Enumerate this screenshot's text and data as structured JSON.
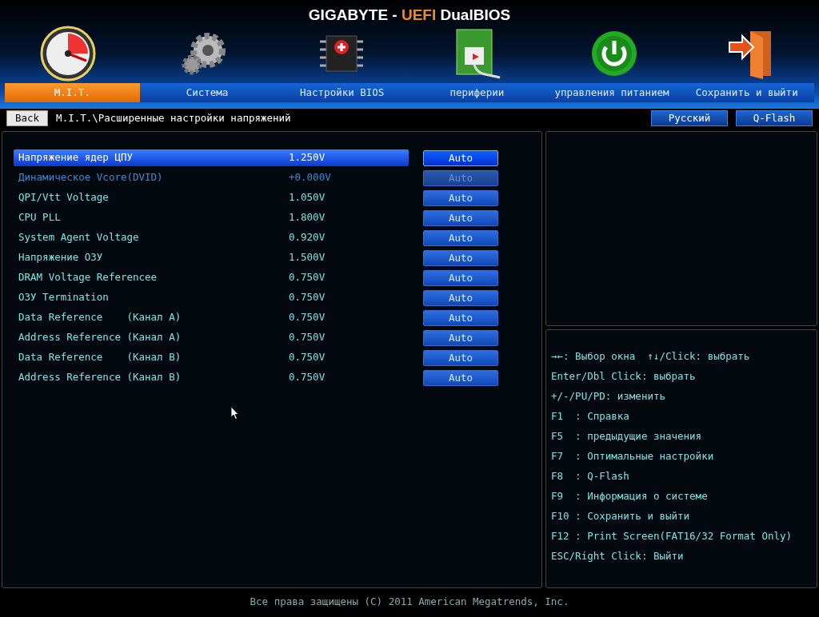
{
  "window": {
    "title_parts": [
      {
        "text": "GIGABYTE - ",
        "accent": false
      },
      {
        "text": "UEFI",
        "accent": true
      },
      {
        "text": " DualBIOS",
        "accent": false
      }
    ]
  },
  "tabs": [
    {
      "label": "M.I.T.",
      "selected": true
    },
    {
      "label": "Система",
      "selected": false
    },
    {
      "label": "Настройки BIOS",
      "selected": false
    },
    {
      "label": "периферии",
      "selected": false
    },
    {
      "label": "управления питанием",
      "selected": false
    },
    {
      "label": "Сохранить и выйти",
      "selected": false
    }
  ],
  "toolbar": {
    "back": "Back",
    "breadcrumb": "M.I.T.\\Расширенные настройки напряжений",
    "buttons": [
      "Русский",
      "Q-Flash"
    ]
  },
  "settings": [
    {
      "name": "Напряжение ядер ЦПУ",
      "value": "1.250V",
      "option": "Auto",
      "selected": true,
      "disabled": false
    },
    {
      "name": "Динамическое Vcore(DVID)",
      "value": "+0.000V",
      "option": "Auto",
      "selected": false,
      "disabled": true
    },
    {
      "name": "QPI/Vtt Voltage",
      "value": "1.050V",
      "option": "Auto",
      "selected": false,
      "disabled": false
    },
    {
      "name": "CPU PLL",
      "value": "1.800V",
      "option": "Auto",
      "selected": false,
      "disabled": false
    },
    {
      "name": "System Agent Voltage",
      "value": "0.920V",
      "option": "Auto",
      "selected": false,
      "disabled": false
    },
    {
      "name": "Напряжение ОЗУ",
      "value": "1.500V",
      "option": "Auto",
      "selected": false,
      "disabled": false
    },
    {
      "name": "DRAM Voltage Referencee",
      "value": "0.750V",
      "option": "Auto",
      "selected": false,
      "disabled": false
    },
    {
      "name": "ОЗУ Termination",
      "value": "0.750V",
      "option": "Auto",
      "selected": false,
      "disabled": false
    },
    {
      "name": "Data Reference    (Канал A)",
      "value": "0.750V",
      "option": "Auto",
      "selected": false,
      "disabled": false
    },
    {
      "name": "Address Reference (Канал A)",
      "value": "0.750V",
      "option": "Auto",
      "selected": false,
      "disabled": false
    },
    {
      "name": "Data Reference    (Канал B)",
      "value": "0.750V",
      "option": "Auto",
      "selected": false,
      "disabled": false
    },
    {
      "name": "Address Reference (Канал B)",
      "value": "0.750V",
      "option": "Auto",
      "selected": false,
      "disabled": false
    }
  ],
  "help": [
    "→←: Выбор окна  ↑↓/Click: выбрать",
    "Enter/Dbl Click: выбрать",
    "+/-/PU/PD: изменить",
    "F1  : Справка",
    "F5  : предыдущие значения",
    "F7  : Оптимальные настройки",
    "F8  : Q-Flash",
    "F9  : Информация о системе",
    "F10 : Сохранить и выйти",
    "F12 : Print Screen(FAT16/32 Format Only)",
    "ESC/Right Click: Выйти"
  ],
  "status_bar": "Все права защищены (C) 2011 American Megatrends, Inc."
}
